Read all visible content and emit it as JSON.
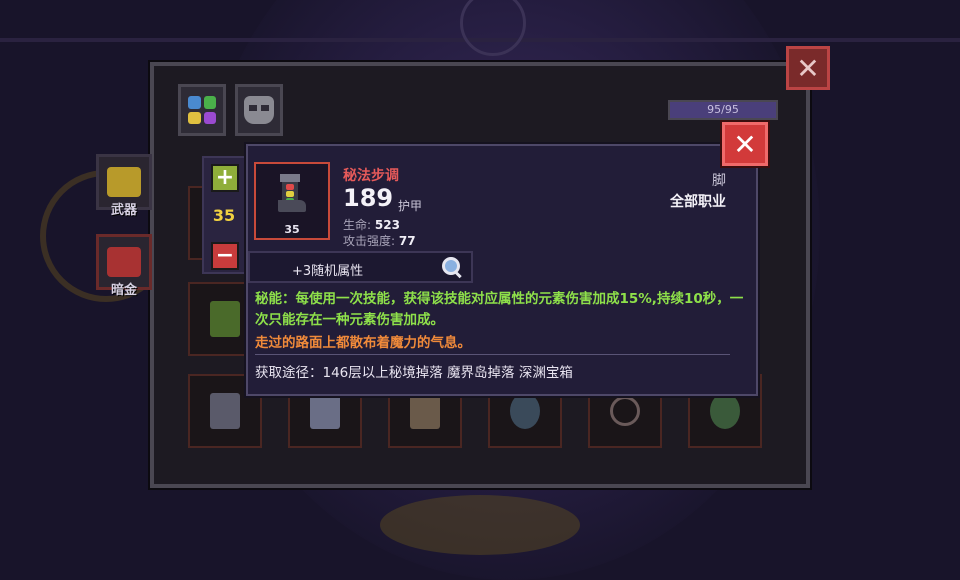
{
  "capacity": {
    "text": "95/95",
    "fill": 1.0
  },
  "side_categories": [
    {
      "label": "武器",
      "color": "#b89a2a"
    },
    {
      "label": "暗金",
      "color": "#a83232"
    }
  ],
  "stepper": {
    "plus_label": "+",
    "minus_label": "−",
    "value": "35"
  },
  "close_glyph": "✕",
  "tooltip": {
    "item_name": "秘法步调",
    "item_level": "35",
    "armor_value": "189",
    "armor_label": "护甲",
    "stats": [
      {
        "label": "生命:",
        "value": "523"
      },
      {
        "label": "攻击强度:",
        "value": "77"
      }
    ],
    "slot_type": "脚",
    "class_requirement": "全部职业",
    "random_affix": "+3随机属性",
    "effect": "秘能：每使用一次技能，获得该技能对应属性的元素伤害加成15%,持续10秒，一次只能存在一种元素伤害加成。",
    "flavor": "走过的路面上都散布着魔力的气息。",
    "source": "获取途径：146层以上秘境掉落 魔界岛掉落 深渊宝箱"
  },
  "colors": {
    "item_name": "#e65a5a",
    "effect": "#8ee04a",
    "flavor": "#f08a3a",
    "close_button": "#d23a3a"
  }
}
